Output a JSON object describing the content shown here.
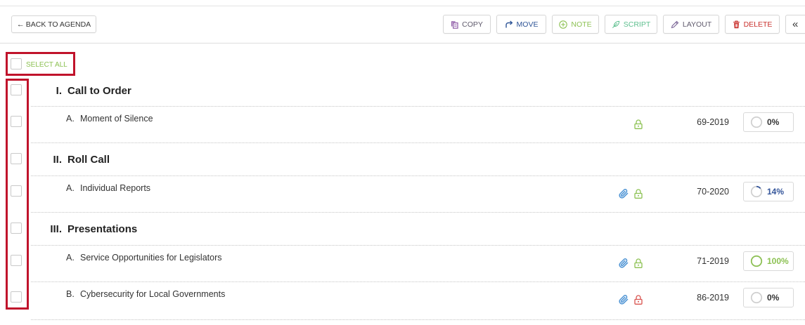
{
  "toolbar": {
    "back_button": {
      "arrow": "←",
      "label": "BACK TO AGENDA"
    },
    "actions": [
      {
        "label": "COPY",
        "icon": "copy-icon",
        "icon_color": "#8e5ba6",
        "label_color": "#5f5a6c"
      },
      {
        "label": "MOVE",
        "icon": "move-arrow-icon",
        "icon_color": "#2f5597",
        "label_color": "#2f5597"
      },
      {
        "label": "NOTE",
        "icon": "add-note-icon",
        "icon_color": "#8cc152",
        "label_color": "#8cc152"
      },
      {
        "label": "SCRIPT",
        "icon": "script-feather-icon",
        "icon_color": "#5dbf8e",
        "label_color": "#5dbf8e"
      },
      {
        "label": "LAYOUT",
        "icon": "pencil-icon",
        "icon_color": "#7a6596",
        "label_color": "#5f5a6c"
      },
      {
        "label": "DELETE",
        "icon": "trash-icon",
        "icon_color": "#c9302c",
        "label_color": "#c9302c"
      }
    ],
    "collapse_label": "«"
  },
  "select_all": {
    "label": "SELECT ALL",
    "checked": false,
    "color": "#8cc152"
  },
  "highlight_color": "#c0132b",
  "icons": {
    "attachment": {
      "name": "paperclip-icon",
      "color": "#4e94d4"
    },
    "lock": "lock-icon"
  },
  "progress_track_color": "#cfcfcf",
  "agenda": [
    {
      "number": "I.",
      "title": "Call to Order",
      "checked": false,
      "items": [
        {
          "letter": "A.",
          "title": "Moment of Silence",
          "checked": false,
          "attachment": false,
          "lock_color": "#8cc152",
          "code": "69-2019",
          "progress": {
            "value": 0,
            "label": "0%",
            "color": "#333333"
          }
        }
      ]
    },
    {
      "number": "II.",
      "title": "Roll Call",
      "checked": false,
      "items": [
        {
          "letter": "A.",
          "title": "Individual Reports",
          "checked": false,
          "attachment": true,
          "lock_color": "#8cc152",
          "code": "70-2020",
          "progress": {
            "value": 14,
            "label": "14%",
            "color": "#34559a"
          }
        }
      ]
    },
    {
      "number": "III.",
      "title": "Presentations",
      "checked": false,
      "items": [
        {
          "letter": "A.",
          "title": "Service Opportunities for Legislators",
          "checked": false,
          "attachment": true,
          "lock_color": "#8cc152",
          "code": "71-2019",
          "progress": {
            "value": 100,
            "label": "100%",
            "color": "#8cc152"
          }
        },
        {
          "letter": "B.",
          "title": "Cybersecurity for Local Governments",
          "checked": false,
          "attachment": true,
          "lock_color": "#d9534f",
          "code": "86-2019",
          "progress": {
            "value": 0,
            "label": "0%",
            "color": "#333333"
          }
        }
      ]
    }
  ]
}
